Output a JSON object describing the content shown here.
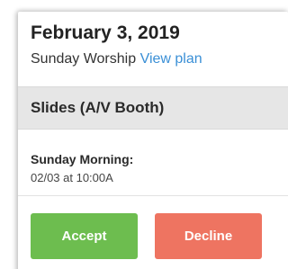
{
  "header": {
    "date": "February 3, 2019",
    "service_name": "Sunday Worship",
    "view_plan_link": "View plan"
  },
  "position": {
    "title": "Slides (A/V Booth)"
  },
  "service_time": {
    "label": "Sunday Morning:",
    "value": "02/03 at 10:00A"
  },
  "actions": {
    "accept_label": "Accept",
    "decline_label": "Decline"
  },
  "colors": {
    "accept": "#6dbd4f",
    "decline": "#ee7461",
    "link": "#3a8fd6",
    "section_header_bg": "#e6e6e6"
  }
}
